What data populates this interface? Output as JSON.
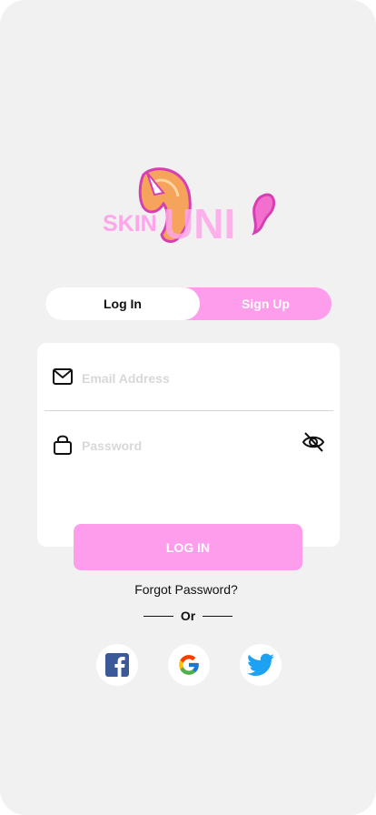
{
  "brand": {
    "logo_text_prefix": "SKIN",
    "logo_text_main": "UNI",
    "colors": {
      "accent": "#ff9ded",
      "logo_text": "#ffa6ea",
      "horse_orange": "#f6a35c",
      "horse_magenta": "#d63fb4"
    }
  },
  "auth_tabs": {
    "login_label": "Log In",
    "signup_label": "Sign Up",
    "active": "login"
  },
  "form": {
    "email": {
      "placeholder": "Email Address",
      "value": "",
      "icon": "mail-icon"
    },
    "password": {
      "placeholder": "Password",
      "value": "",
      "icon": "lock-icon",
      "toggle_icon": "eye-off-icon"
    }
  },
  "actions": {
    "login_button": "LOG IN",
    "forgot_password": "Forgot Password?",
    "or_label": "Or"
  },
  "social": [
    {
      "name": "facebook",
      "icon": "facebook-icon"
    },
    {
      "name": "google",
      "icon": "google-icon"
    },
    {
      "name": "twitter",
      "icon": "twitter-icon"
    }
  ]
}
